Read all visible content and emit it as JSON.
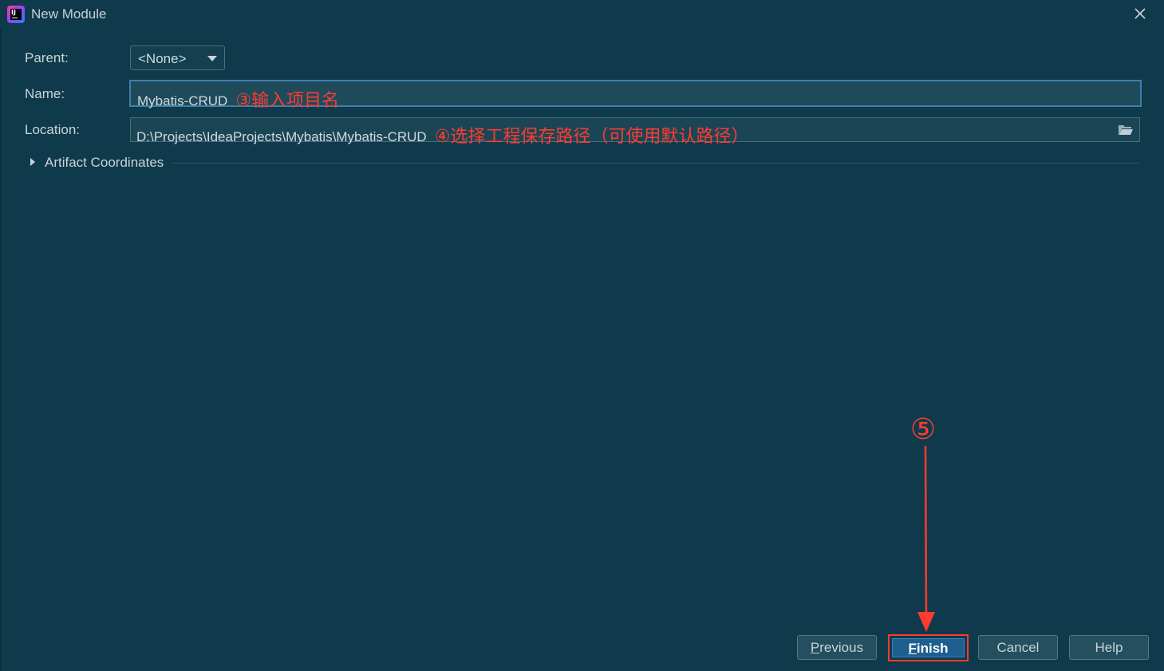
{
  "window": {
    "title": "New Module",
    "app_icon": "intellij-idea-icon",
    "close_icon": "close-icon"
  },
  "form": {
    "parent_label": "Parent:",
    "parent_value": "<None>",
    "name_label": "Name:",
    "name_value": "Mybatis-CRUD",
    "name_annotation": "③输入项目名",
    "location_label": "Location:",
    "location_value": "D:\\Projects\\IdeaProjects\\Mybatis\\Mybatis-CRUD",
    "location_annotation": "④选择工程保存路径（可使用默认路径）",
    "browse_icon": "folder-open-icon",
    "artifact_section": "Artifact Coordinates"
  },
  "buttons": {
    "previous_first": "P",
    "previous_rest": "revious",
    "finish_first": "F",
    "finish_rest": "inish",
    "cancel": "Cancel",
    "help": "Help"
  },
  "annotations": {
    "step5": "⑤",
    "color": "#ff3b30"
  },
  "colors": {
    "background": "#0f3a4b",
    "accent": "#3f7fae",
    "finish_button": "#1f5f8f"
  }
}
